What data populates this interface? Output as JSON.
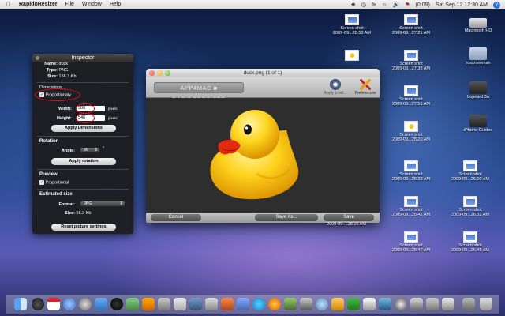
{
  "menubar": {
    "app_name": "RapidoResizer",
    "menus": [
      "File",
      "Window",
      "Help"
    ],
    "battery": "(0:09)",
    "datetime": "Sat Sep 12  12:30 AM"
  },
  "inspector": {
    "title": "Inspector",
    "name_label": "Name:",
    "name_value": "duck",
    "type_label": "Type:",
    "type_value": "PNG",
    "size_label": "Size:",
    "size_value": "156.3 Kb",
    "dimensions_heading": "Dimensions",
    "proportionaly_label": "Proportionaly",
    "width_label": "Width:",
    "width_value": "500",
    "width_unit": "pixels",
    "height_label": "Height:",
    "height_value": "546",
    "height_unit": "pixels",
    "apply_dimensions_label": "Apply Dimensions",
    "rotation_heading": "Rotation",
    "angle_label": "Angle:",
    "angle_value": "90",
    "angle_unit": "°",
    "apply_rotation_label": "Apply rotation",
    "preview_heading": "Preview",
    "proportional_label": "Proportional",
    "estimated_heading": "Estimated size",
    "format_label": "Format:",
    "format_value": "JPG",
    "est_size_label": "Size:",
    "est_size_value": "56.3 Kb",
    "reset_label": "Reset picture settings"
  },
  "window": {
    "title": "duck.png (1 of 1)",
    "logo_text": "APP4MAC  ■  RAPIDORESIZER",
    "apply_all_label": "Apply to all...",
    "preferences_label": "Preferences",
    "cancel_label": "Cancel",
    "save_as_label": "Save As...",
    "save_label": "Save",
    "behind_text": "2009-09-...28.16 AM"
  },
  "desktop": {
    "screenshots": [
      {
        "label": "Screen shot",
        "date": "2009-09...28.53 AM"
      },
      {
        "label": "Screen shot",
        "date": "2009-09...27.21 AM"
      },
      {
        "label": "Screen shot",
        "date": "2009-09...27.38 AM"
      },
      {
        "label": "Screen shot",
        "date": "2009-09...27.51 AM"
      },
      {
        "label": "Screen shot",
        "date": "2009-09...28.20 AM"
      },
      {
        "label": "Screen shot",
        "date": "2009-09...28.33 AM"
      },
      {
        "label": "Screen shot",
        "date": "2009-09...26.00 AM"
      },
      {
        "label": "Screen shot",
        "date": "2009-09...28.42 AM"
      },
      {
        "label": "Screen shot",
        "date": "2009-09...26.32 AM"
      },
      {
        "label": "Screen shot",
        "date": "2009-09...28.47 AM"
      },
      {
        "label": "Screen shot",
        "date": "2009-09...26.45 AM"
      }
    ],
    "drives": [
      {
        "label": "Macintosh HD"
      },
      {
        "label": "rossnewman"
      },
      {
        "label": "Lopeard 3a"
      },
      {
        "label": "iPhone Guides"
      }
    ]
  }
}
